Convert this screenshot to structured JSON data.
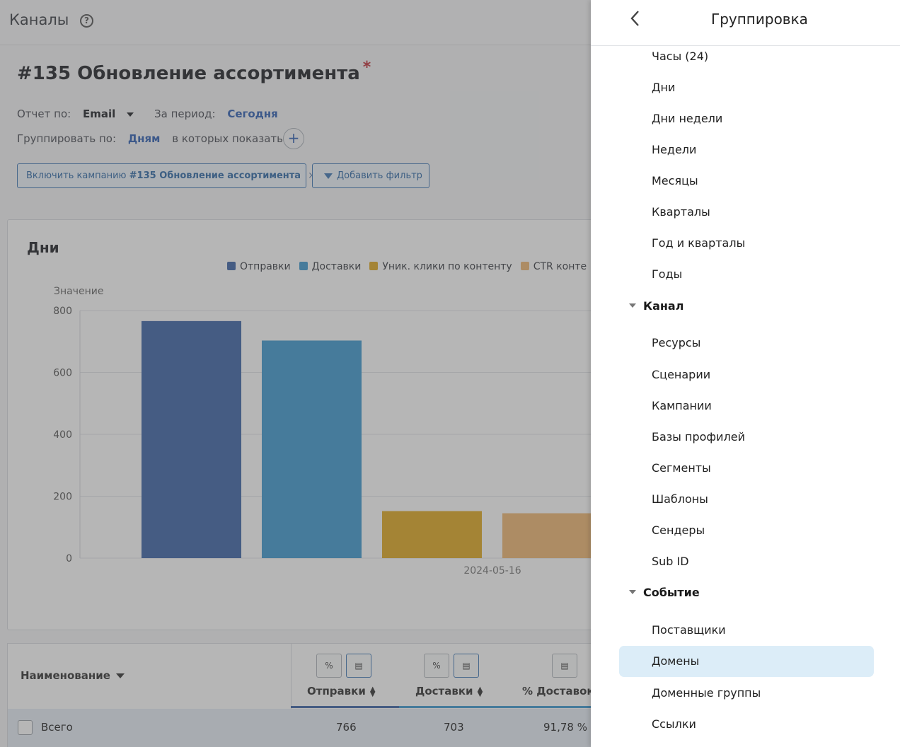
{
  "header": {
    "title": "Каналы"
  },
  "campaign": {
    "title": "#135 Обновление ассортимента",
    "required_mark": "*"
  },
  "filters": {
    "report_by_label": "Отчет по:",
    "report_by_value": "Email",
    "period_label": "За период:",
    "period_value": "Сегодня",
    "group_by_label": "Группировать по:",
    "group_by_value": "Дням",
    "show_in_label": "в которых показать:",
    "add_symbol": "+",
    "chip_prefix": "Включить кампанию",
    "chip_campaign": "#135 Обновление ассортимента",
    "chip_close": "×",
    "add_filter": "Добавить фильтр"
  },
  "chart_data": {
    "type": "bar",
    "title": "Дни",
    "ylabel": "Значение",
    "ylim": [
      0,
      800
    ],
    "yticks": [
      "0",
      "200",
      "400",
      "600",
      "800"
    ],
    "categories": [
      "2024-05-16"
    ],
    "legend_position": "top-center",
    "series": [
      {
        "name": "Отправки",
        "values": [
          766
        ],
        "color": "#3d64a8"
      },
      {
        "name": "Доставки",
        "values": [
          703
        ],
        "color": "#3e9ad0"
      },
      {
        "name": "Уник. клики по контенту",
        "values": [
          152
        ],
        "color": "#e0aa21"
      },
      {
        "name": "CTR конте",
        "values": [
          145
        ],
        "color": "#f0b772"
      }
    ]
  },
  "table": {
    "name_header": "Наименование",
    "percent_symbol": "%",
    "columns": [
      {
        "label": "Отправки",
        "total": "766",
        "color": "#3d64a8"
      },
      {
        "label": "Доставки",
        "total": "703",
        "color": "#3e9ad0"
      },
      {
        "label": "% Доставок",
        "total": "91,78 %",
        "color": "#3e9ad0"
      }
    ],
    "total_label": "Всего"
  },
  "drawer": {
    "title": "Группировка",
    "items": [
      {
        "type": "item",
        "label": "Часы (24)"
      },
      {
        "type": "item",
        "label": "Дни"
      },
      {
        "type": "item",
        "label": "Дни недели"
      },
      {
        "type": "item",
        "label": "Недели"
      },
      {
        "type": "item",
        "label": "Месяцы"
      },
      {
        "type": "item",
        "label": "Кварталы"
      },
      {
        "type": "item",
        "label": "Год и кварталы"
      },
      {
        "type": "item",
        "label": "Годы"
      },
      {
        "type": "group",
        "label": "Канал"
      },
      {
        "type": "item",
        "label": "Ресурсы"
      },
      {
        "type": "item",
        "label": "Сценарии"
      },
      {
        "type": "item",
        "label": "Кампании"
      },
      {
        "type": "item",
        "label": "Базы профилей"
      },
      {
        "type": "item",
        "label": "Сегменты"
      },
      {
        "type": "item",
        "label": "Шаблоны"
      },
      {
        "type": "item",
        "label": "Сендеры"
      },
      {
        "type": "item",
        "label": "Sub ID"
      },
      {
        "type": "group",
        "label": "Событие"
      },
      {
        "type": "item",
        "label": "Поставщики"
      },
      {
        "type": "item",
        "label": "Домены",
        "selected": true
      },
      {
        "type": "item",
        "label": "Доменные группы"
      },
      {
        "type": "item",
        "label": "Ссылки"
      }
    ]
  }
}
